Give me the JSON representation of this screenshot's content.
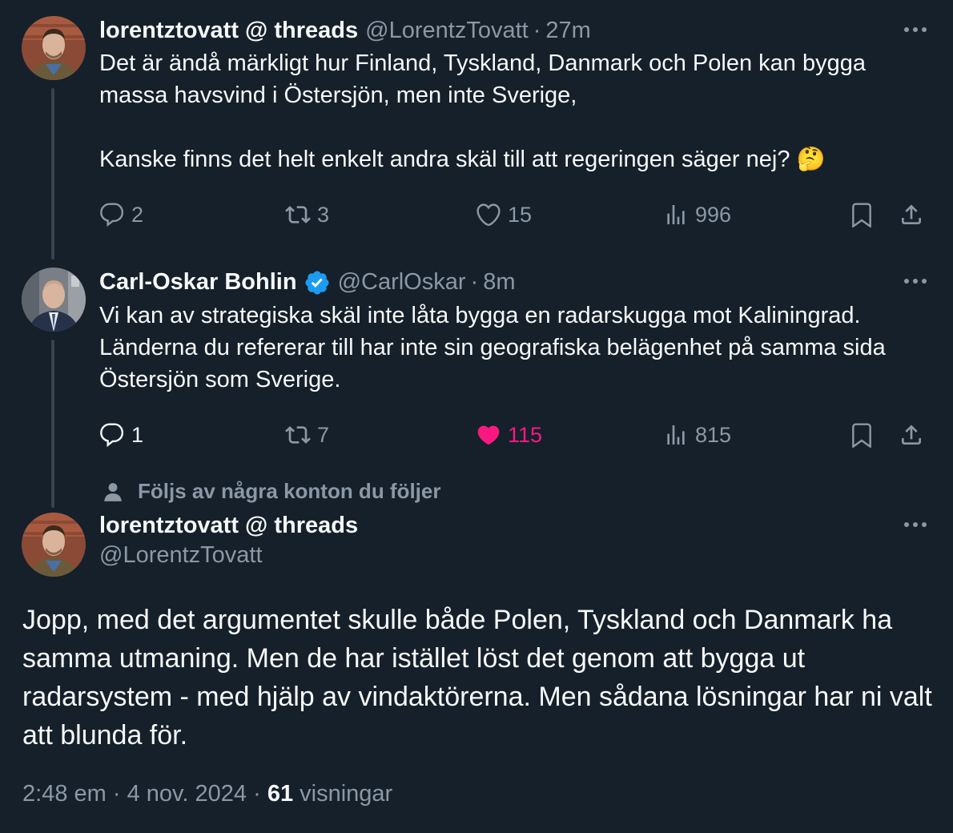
{
  "tweets": [
    {
      "name": "lorentztovatt @ threads",
      "handle": "@LorentzTovatt",
      "dot": "·",
      "time": "27m",
      "text": "Det är ändå märkligt hur Finland, Tyskland, Danmark och Polen kan bygga massa havsvind i Östersjön, men inte Sverige,\n\nKanske finns det helt enkelt andra skäl till att regeringen säger nej? 🤔",
      "replies": "2",
      "retweets": "3",
      "likes": "15",
      "views": "996"
    },
    {
      "name": "Carl-Oskar Bohlin",
      "handle": "@CarlOskar",
      "dot": "·",
      "time": "8m",
      "text": "Vi kan av strategiska skäl inte låta bygga en radarskugga mot Kaliningrad. Länderna du refererar till har inte sin geografiska belägenhet på samma sida Östersjön som Sverige.",
      "replies": "1",
      "retweets": "7",
      "likes": "115",
      "views": "815"
    }
  ],
  "social_context": "Följs av några konton du följer",
  "main_tweet": {
    "name": "lorentztovatt @ threads",
    "handle": "@LorentzTovatt",
    "text": "Jopp, med det argumentet skulle både Polen, Tyskland och Danmark ha samma utmaning. Men de har istället löst det genom att bygga ut radarsystem - med hjälp av vindaktörerna. Men sådana lösningar har ni valt att blunda för.",
    "time": "2:48 em",
    "sep": "·",
    "date": "4 nov. 2024",
    "views_count": "61",
    "views_label": "visningar"
  },
  "colors": {
    "background": "#15202b",
    "text": "#f7f9f9",
    "secondary": "#8b98a5",
    "like": "#f91880",
    "verified": "#1d9bf0",
    "thread_line": "#38444d"
  },
  "icons": [
    "reply-icon",
    "retweet-icon",
    "heart-icon",
    "views-icon",
    "bookmark-icon",
    "share-icon",
    "more-icon",
    "verified-icon",
    "person-icon"
  ]
}
